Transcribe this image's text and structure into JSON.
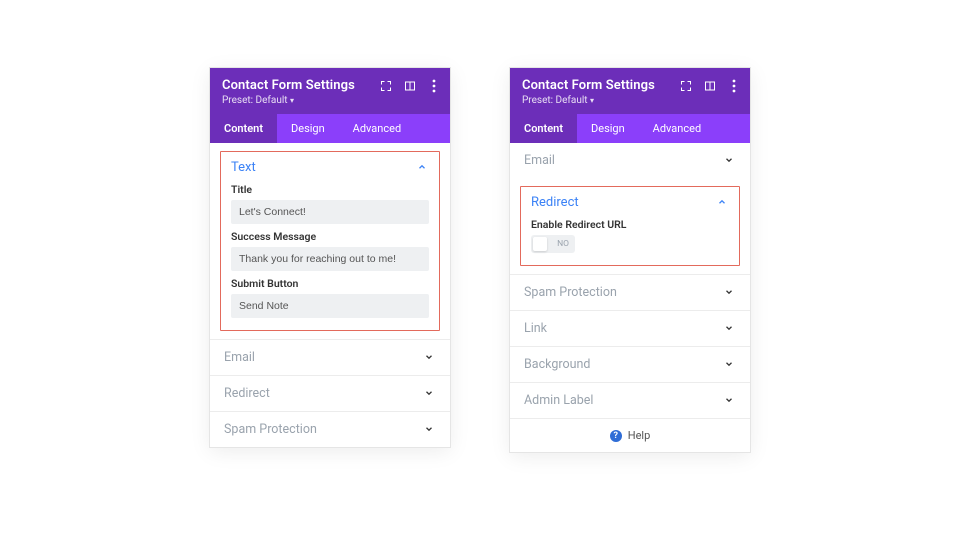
{
  "header": {
    "title": "Contact Form Settings",
    "preset": "Preset: Default"
  },
  "tabs": {
    "content": "Content",
    "design": "Design",
    "advanced": "Advanced"
  },
  "left": {
    "text_section": "Text",
    "title_label": "Title",
    "title_value": "Let's Connect!",
    "success_label": "Success Message",
    "success_value": "Thank you for reaching out to me!",
    "submit_label": "Submit Button",
    "submit_value": "Send Note",
    "email": "Email",
    "redirect": "Redirect",
    "spam": "Spam Protection"
  },
  "right": {
    "email": "Email",
    "redirect_section": "Redirect",
    "enable_redirect_label": "Enable Redirect URL",
    "toggle_no": "NO",
    "spam": "Spam Protection",
    "link": "Link",
    "background": "Background",
    "admin_label": "Admin Label",
    "help": "Help"
  }
}
